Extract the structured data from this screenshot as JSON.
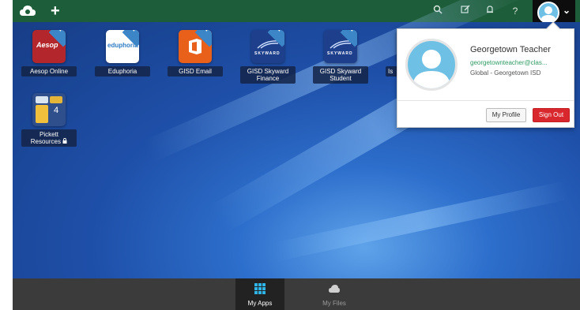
{
  "colors": {
    "topbar": "#1e5d39",
    "accent": "#3c86c7",
    "signout": "#d9272e"
  },
  "topbar": {
    "logo_icon": "cloud-logo-icon",
    "add_icon": "plus-icon",
    "icons": [
      "search-icon",
      "edit-icon",
      "bell-icon",
      "help-icon"
    ],
    "help_label": "?",
    "avatar_icon": "user-avatar-icon",
    "menu_icon": "chevron-down-icon"
  },
  "apps": [
    {
      "label": "Aesop Online",
      "logo": "Aesop"
    },
    {
      "label": "Eduphoria",
      "logo": "eduphoria"
    },
    {
      "label": "GISD Email",
      "logo": "office-icon"
    },
    {
      "label": "GISD Skyward Finance",
      "logo": "SKYWARD"
    },
    {
      "label": "GISD Skyward Student",
      "logo": "SKYWARD"
    },
    {
      "label": "Is",
      "logo": ""
    },
    {
      "label": "Pickett Resources",
      "logo": "4"
    }
  ],
  "profile_menu": {
    "name": "Georgetown Teacher",
    "email": "georgetownteacher@clas...",
    "org": "Global - Georgetown ISD",
    "my_profile": "My Profile",
    "sign_out": "Sign Out"
  },
  "bottom_nav": [
    {
      "label": "My Apps",
      "icon": "grid-icon",
      "active": true
    },
    {
      "label": "My Files",
      "icon": "cloud-icon",
      "active": false
    }
  ]
}
